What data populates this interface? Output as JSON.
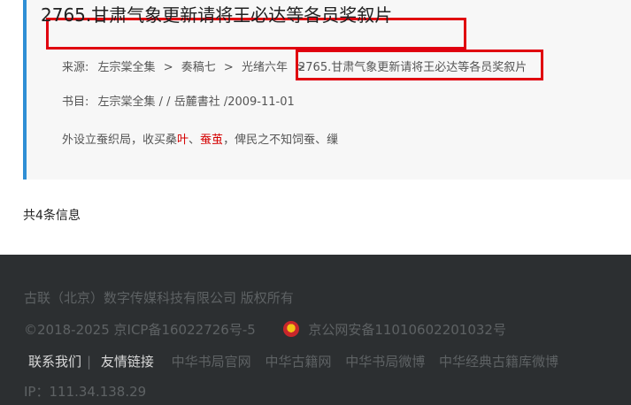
{
  "result": {
    "title": "2765.甘肃气象更新请将王必达等各员奖叙片",
    "source_label": "来源:",
    "breadcrumb": [
      "左宗棠全集",
      "奏稿七",
      "光绪六年"
    ],
    "breadcrumb_current": "2765.甘肃气象更新请将王必达等各员奖叙片",
    "book_label": "书目:",
    "book_info": "左宗棠全集 / / 岳麓書社 /2009-11-01",
    "snippet_pre": "外设立蚕织局，收买桑",
    "snippet_hl1": "叶",
    "snippet_mid": "、",
    "snippet_hl2": "蚕茧",
    "snippet_post": "，俾民之不知饲蚕、缫"
  },
  "count_text": "共4条信息",
  "footer": {
    "copyright": "古联（北京）数字传媒科技有限公司 版权所有",
    "icp": "©2018-2025 京ICP备16022726号-5",
    "police": "京公网安备11010602201032号",
    "contact": "联系我们",
    "friends": "友情链接",
    "links": [
      "中华书局官网",
      "中华古籍网",
      "中华书局微博",
      "中华经典古籍库微博"
    ],
    "ip": "IP：111.34.138.29"
  },
  "colors": {
    "accent_border": "#2f8fd5",
    "highlight_box": "#e0000f",
    "keyword": "#d40000",
    "footer_bg": "#2c2f31"
  }
}
